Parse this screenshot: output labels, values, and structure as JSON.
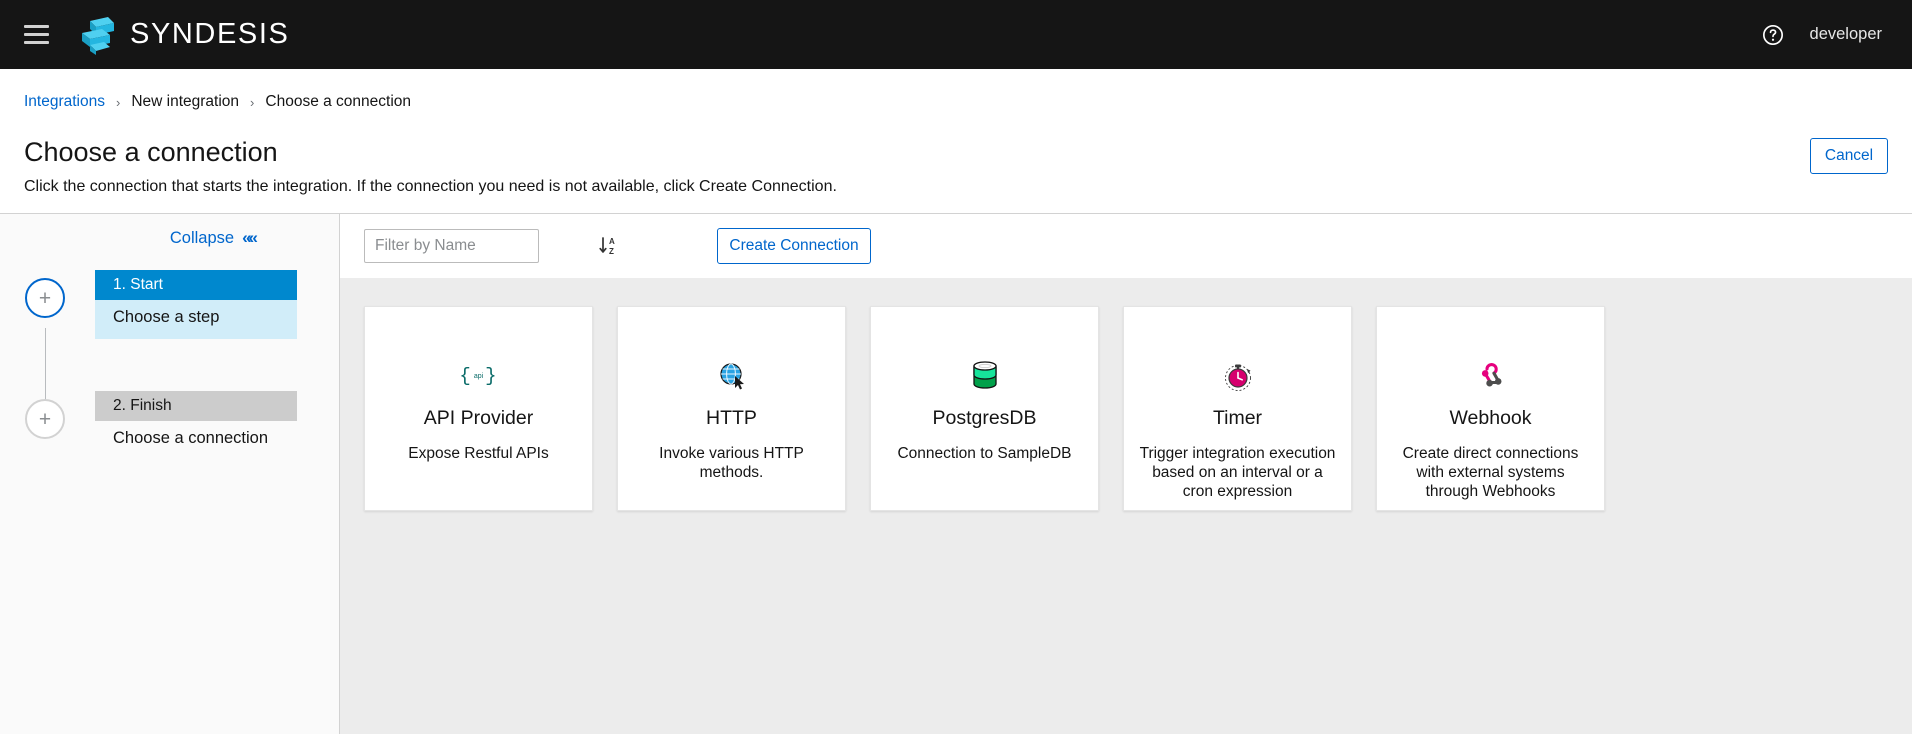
{
  "topnav": {
    "menu_icon": "hamburger-icon",
    "logo_icon": "syndesis-logo-icon",
    "brand": "SYNDESIS",
    "help_icon": "help-circle-icon",
    "username": "developer"
  },
  "breadcrumb": {
    "items": [
      {
        "label": "Integrations",
        "link": true
      },
      {
        "label": "New integration",
        "link": false
      },
      {
        "label": "Choose a connection",
        "link": false
      }
    ],
    "separator": "›"
  },
  "page": {
    "title": "Choose a connection",
    "subtitle": "Click the connection that starts the integration. If the connection you need is not available, click Create Connection.",
    "cancel_label": "Cancel"
  },
  "sidebar": {
    "collapse_label": "Collapse",
    "collapse_icon": "chevron-double-left-icon",
    "add_step_icon": "plus-icon",
    "steps": [
      {
        "head": "1. Start",
        "body": "Choose a step",
        "state": "active"
      },
      {
        "head": "2. Finish",
        "body": "Choose a connection",
        "state": "inactive"
      }
    ]
  },
  "toolbar": {
    "filter_placeholder": "Filter by Name",
    "filter_value": "",
    "sort_icon": "sort-alpha-asc-icon",
    "create_label": "Create Connection"
  },
  "connections": [
    {
      "icon": "api-provider-icon",
      "name": "API Provider",
      "description": "Expose Restful APIs"
    },
    {
      "icon": "http-globe-cursor-icon",
      "name": "HTTP",
      "description": "Invoke various HTTP methods."
    },
    {
      "icon": "postgres-database-icon",
      "name": "PostgresDB",
      "description": "Connection to SampleDB"
    },
    {
      "icon": "timer-stopwatch-icon",
      "name": "Timer",
      "description": "Trigger integration execution based on an interval or a cron expression"
    },
    {
      "icon": "webhook-icon",
      "name": "Webhook",
      "description": "Create direct connections with external systems through Webhooks"
    }
  ],
  "colors": {
    "brand_cyan": "#34c6eb",
    "link_blue": "#0066cc",
    "step_active_blue": "#0088ce",
    "step_active_body": "#d1edf9",
    "step_inactive_grey": "#cccccc",
    "nav_black": "#151515",
    "content_bg": "#ececec",
    "api_teal": "#096b68",
    "postgres_green": "#00b04f",
    "timer_pink": "#d6006e",
    "webhook_pink": "#e6007e"
  }
}
